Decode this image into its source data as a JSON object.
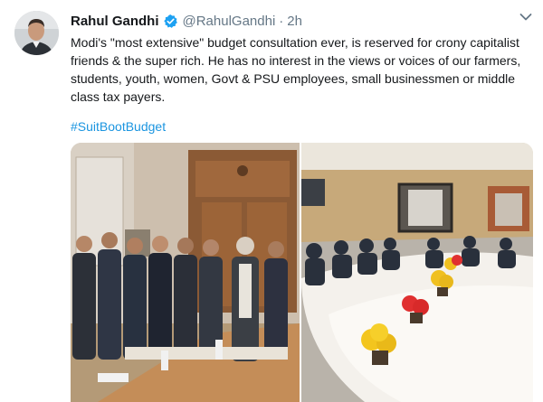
{
  "tweet": {
    "display_name": "Rahul Gandhi",
    "handle": "@RahulGandhi",
    "separator": "·",
    "time": "2h",
    "text": "Modi's \"most extensive\" budget consultation ever, is reserved for crony capitalist friends & the super rich. He has no interest in the views or voices of our farmers, students, youth, women, Govt & PSU employees, small businessmen or middle class tax payers.",
    "hashtag": "#SuitBootBudget"
  },
  "icons": {
    "verified": "verified-badge-icon",
    "caret": "chevron-down-icon"
  },
  "colors": {
    "link": "#1b95e0",
    "verified": "#1da1f2",
    "secondary_text": "#657786",
    "primary_text": "#14171a"
  }
}
